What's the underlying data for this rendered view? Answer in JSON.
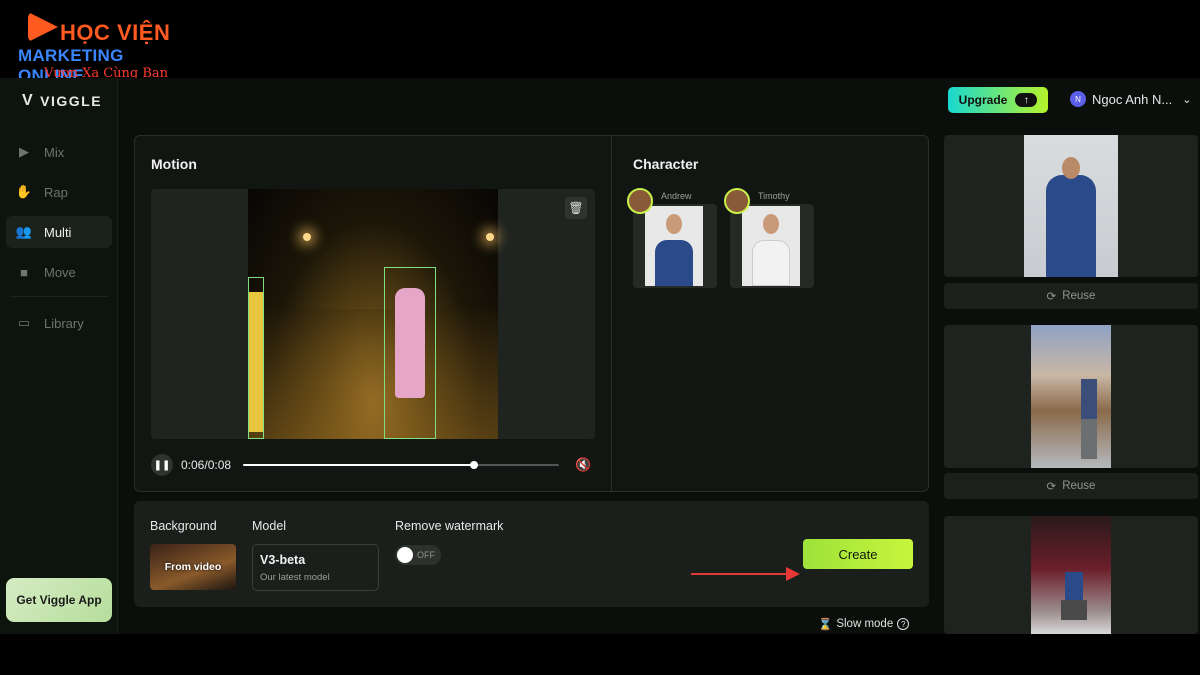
{
  "brand": {
    "line1": "HỌC VIỆN",
    "line2": "MARKETING ONLINE",
    "line3": "Vươn Xa Cùng Bạn"
  },
  "app": {
    "logo": "VIGGLE"
  },
  "sidebar": {
    "items": [
      {
        "label": "Mix",
        "icon": "play-icon"
      },
      {
        "label": "Rap",
        "icon": "hand-icon"
      },
      {
        "label": "Multi",
        "icon": "users-icon"
      },
      {
        "label": "Move",
        "icon": "person-icon"
      },
      {
        "label": "Library",
        "icon": "stack-icon"
      }
    ],
    "get_app": "Get Viggle App"
  },
  "header": {
    "upgrade": "Upgrade",
    "user_name": "Ngoc Anh N...",
    "user_initial": "N"
  },
  "motion": {
    "title": "Motion",
    "time": "0:06/0:08",
    "progress": 0.73
  },
  "character": {
    "title": "Character",
    "items": [
      {
        "name": "Andrew"
      },
      {
        "name": "Timothy"
      }
    ]
  },
  "settings": {
    "background_label": "Background",
    "background_value": "From video",
    "model_label": "Model",
    "model_name": "V3-beta",
    "model_sub": "Our latest model",
    "watermark_label": "Remove watermark",
    "watermark_state": "OFF",
    "create": "Create"
  },
  "slow_mode": "Slow mode",
  "history": {
    "reuse": "Reuse"
  },
  "colors": {
    "accent": "#c8f53c",
    "active_icon": "#3ddc84",
    "arrow": "#e53935"
  }
}
